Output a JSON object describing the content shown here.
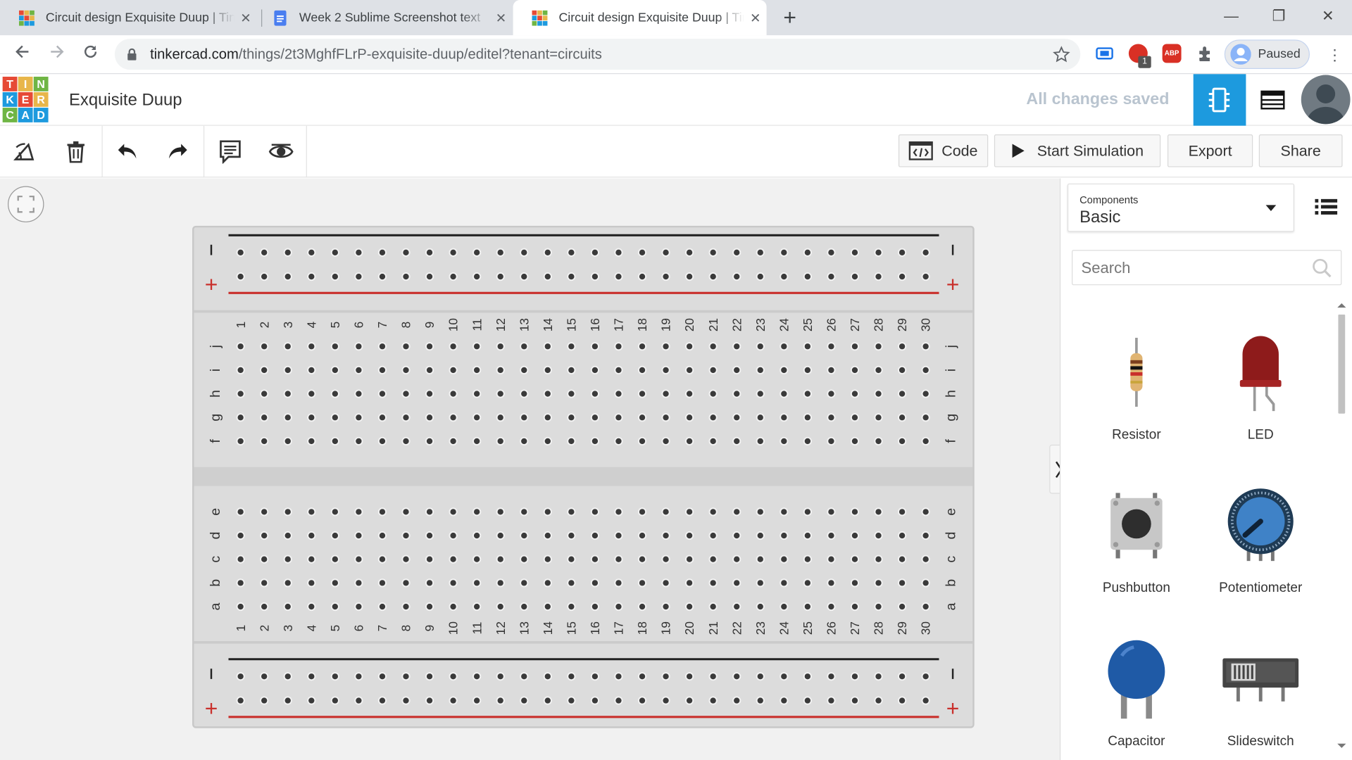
{
  "browser": {
    "tabs": [
      {
        "title": "Circuit design Exquisite Duup | Tinkercad",
        "favicon": "tinkercad-favicon",
        "active": false
      },
      {
        "title": "Week 2 Sublime Screenshot text",
        "favicon": "google-docs-favicon",
        "active": false
      },
      {
        "title": "Circuit design Exquisite Duup | Tinkercad",
        "favicon": "tinkercad-favicon",
        "active": true
      }
    ],
    "new_tab_glyph": "+",
    "close_glyph": "✕",
    "window_controls": {
      "minimize": "—",
      "maximize": "❐",
      "close": "✕"
    },
    "url_host": "tinkercad.com",
    "url_path": "/things/2t3MghfFLrP-exquisite-duup/editel?tenant=circuits",
    "extension_badge": "1",
    "abp_label": "ABP",
    "profile_status": "Paused"
  },
  "app": {
    "logo_letters": [
      "T",
      "I",
      "N",
      "K",
      "E",
      "R",
      "C",
      "A",
      "D"
    ],
    "logo_colors": [
      "#e64a36",
      "#e8b64a",
      "#6fb544",
      "#1d9ade",
      "#e64a36",
      "#e8b64a",
      "#6fb544",
      "#1d9ade",
      "#1d9ade"
    ],
    "design_title": "Exquisite Duup",
    "save_status": "All changes saved",
    "accent_color": "#1d9ade"
  },
  "toolbar": {
    "code_label": "Code",
    "simulate_label": "Start Simulation",
    "export_label": "Export",
    "share_label": "Share"
  },
  "breadboard": {
    "columns": [
      "1",
      "2",
      "3",
      "4",
      "5",
      "6",
      "7",
      "8",
      "9",
      "10",
      "11",
      "12",
      "13",
      "14",
      "15",
      "16",
      "17",
      "18",
      "19",
      "20",
      "21",
      "22",
      "23",
      "24",
      "25",
      "26",
      "27",
      "28",
      "29",
      "30"
    ],
    "top_rows": [
      "j",
      "i",
      "h",
      "g",
      "f"
    ],
    "bottom_rows": [
      "e",
      "d",
      "c",
      "b",
      "a"
    ],
    "minus_symbol": "—",
    "plus_symbol": "+",
    "negative_rail_color": "#222222",
    "positive_rail_color": "#c9302c"
  },
  "panel": {
    "category_caption": "Components",
    "category_value": "Basic",
    "search_placeholder": "Search",
    "components": [
      {
        "name": "Resistor",
        "icon": "resistor-icon"
      },
      {
        "name": "LED",
        "icon": "led-icon"
      },
      {
        "name": "Pushbutton",
        "icon": "pushbutton-icon"
      },
      {
        "name": "Potentiometer",
        "icon": "potentiometer-icon"
      },
      {
        "name": "Capacitor",
        "icon": "capacitor-icon"
      },
      {
        "name": "Slideswitch",
        "icon": "slideswitch-icon"
      }
    ]
  }
}
